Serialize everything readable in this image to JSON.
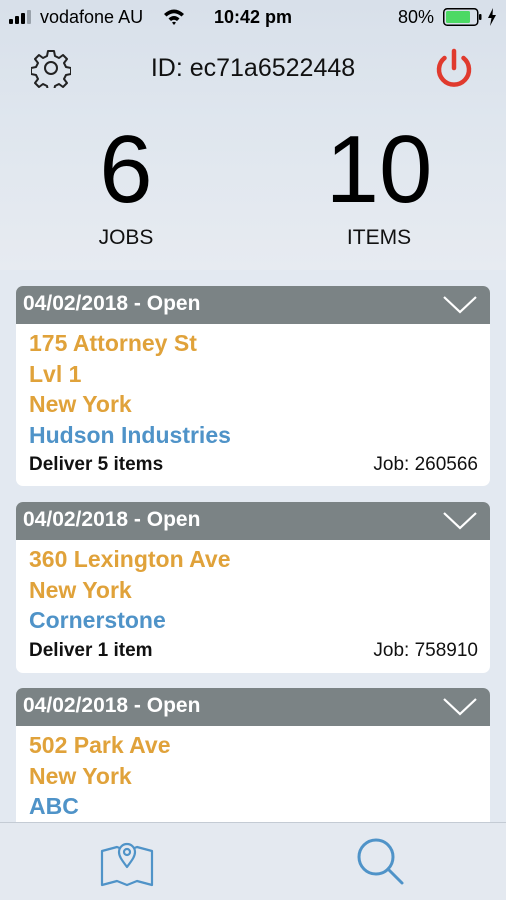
{
  "status_bar": {
    "carrier": "vodafone AU",
    "time": "10:42 pm",
    "battery_percent": "80%",
    "battery_level": 0.8,
    "signal_bars": 3,
    "icons": [
      "signal-icon",
      "wifi-icon",
      "battery-icon",
      "charging-bolt-icon"
    ]
  },
  "header": {
    "device_id": "ID: ec71a6522448",
    "settings_icon": "gear-icon",
    "power_icon": "power-icon"
  },
  "stats": {
    "jobs_count": "6",
    "jobs_label": "JOBS",
    "items_count": "10",
    "items_label": "ITEMS"
  },
  "jobs": [
    {
      "header": "04/02/2018 - Open",
      "address_lines": [
        "175 Attorney St",
        "Lvl 1",
        "New York"
      ],
      "company": "Hudson Industries",
      "deliver": "Deliver 5 items",
      "job": "Job: 260566"
    },
    {
      "header": "04/02/2018 - Open",
      "address_lines": [
        "360 Lexington Ave",
        "New York"
      ],
      "company": "Cornerstone",
      "deliver": "Deliver 1 item",
      "job": "Job: 758910"
    },
    {
      "header": "04/02/2018 - Open",
      "address_lines": [
        "502 Park Ave",
        "New York"
      ],
      "company": "ABC",
      "deliver": "",
      "job": ""
    }
  ],
  "tab_bar": {
    "tabs": [
      {
        "icon": "map-icon"
      },
      {
        "icon": "search-icon"
      }
    ]
  },
  "colors": {
    "address": "#e0a23a",
    "company": "#4f93c8",
    "card_header": "#7b8385",
    "power": "#e03a2e",
    "tab_icon": "#4f93c8",
    "battery_fill": "#4cd964"
  }
}
